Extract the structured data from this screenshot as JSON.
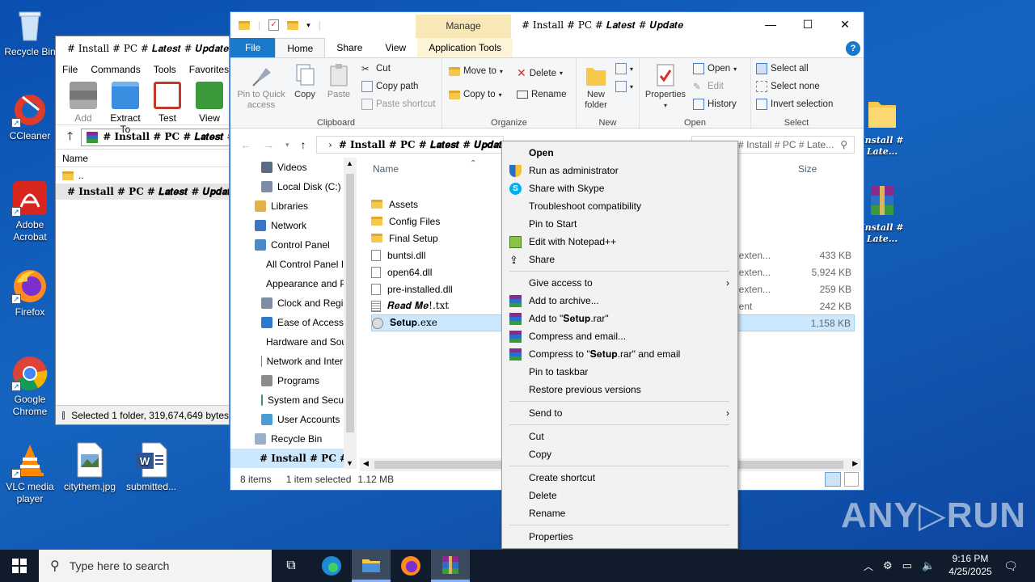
{
  "desktop_icons": [
    {
      "label": "Recycle Bin"
    },
    {
      "label": "CCleaner"
    },
    {
      "label": "Adobe Acrobat"
    },
    {
      "label": "Firefox"
    },
    {
      "label": "Google Chrome"
    },
    {
      "label": "VLC media player"
    },
    {
      "label": "citythem.jpg"
    },
    {
      "label": "submitted..."
    }
  ],
  "right_icons": [
    {
      "line1": "Install #",
      "line2": "Late..."
    },
    {
      "line1": "Install #",
      "line2": "Late..."
    }
  ],
  "winrar": {
    "title": "# Install # PC # 𝑳𝒂𝒕𝒆𝒔𝒕 # 𝑼𝒑𝒅𝒂𝒕𝒆",
    "menu": [
      "File",
      "Commands",
      "Tools",
      "Favorites"
    ],
    "tools": [
      "Add",
      "Extract To",
      "Test",
      "View"
    ],
    "address": "# Install # PC # 𝑳𝒂𝒕𝒆𝒔𝒕 # 𝑼𝒑𝒅𝒂𝒕𝒆",
    "col_name": "Name",
    "rows": [
      "..",
      "# Install # PC # 𝑳𝒂𝒕𝒆𝒔𝒕 # 𝑼𝒑𝒅𝒂𝒕𝒆"
    ],
    "status": "Selected 1 folder, 319,674,649 bytes"
  },
  "explorer": {
    "manage": "Manage",
    "title": "# Install # PC # 𝑳𝒂𝒕𝒆𝒔𝒕 # 𝑼𝒑𝒅𝒂𝒕𝒆",
    "tabs": {
      "file": "File",
      "home": "Home",
      "share": "Share",
      "view": "View",
      "app": "Application Tools"
    },
    "help": "?",
    "ribbon": {
      "clipboard": {
        "label": "Clipboard",
        "pin": "Pin to Quick access",
        "copy": "Copy",
        "paste": "Paste",
        "cut": "Cut",
        "copy_path": "Copy path",
        "paste_shortcut": "Paste shortcut"
      },
      "organize": {
        "label": "Organize",
        "move_to": "Move to",
        "copy_to": "Copy to",
        "delete": "Delete",
        "rename": "Rename"
      },
      "new": {
        "label": "New",
        "new_folder": "New folder"
      },
      "open": {
        "label": "Open",
        "properties": "Properties",
        "open": "Open",
        "edit": "Edit",
        "history": "History"
      },
      "select": {
        "label": "Select",
        "select_all": "Select all",
        "select_none": "Select none",
        "invert": "Invert selection"
      }
    },
    "address": "# Install # PC # 𝑳𝒂𝒕𝒆𝒔𝒕 # 𝑼𝒑𝒅𝒂𝒕𝒆",
    "search_placeholder": "Search # Install # PC # Late...",
    "nav": [
      {
        "label": "Videos",
        "color": "#5b6b84"
      },
      {
        "label": "Local Disk (C:)",
        "color": "#7a8ca8"
      },
      {
        "label": "Libraries",
        "color": "#e2b24a"
      },
      {
        "label": "Network",
        "color": "#3a76c4"
      },
      {
        "label": "Control Panel",
        "color": "#4a8ac8"
      },
      {
        "label": "All Control Panel Items",
        "color": "#4a8ac8"
      },
      {
        "label": "Appearance and Personalization",
        "color": "#6a5fc2"
      },
      {
        "label": "Clock and Region",
        "color": "#7d8ea4"
      },
      {
        "label": "Ease of Access",
        "color": "#2b7ad0"
      },
      {
        "label": "Hardware and Sound",
        "color": "#6b7d92"
      },
      {
        "label": "Network and Internet",
        "color": "#3a8fd0"
      },
      {
        "label": "Programs",
        "color": "#8c8c8c"
      },
      {
        "label": "System and Security",
        "color": "#3a9b5c"
      },
      {
        "label": "User Accounts",
        "color": "#4c9bd6"
      },
      {
        "label": "Recycle Bin",
        "color": "#9ab0c8"
      },
      {
        "label": "# Install # PC # Latest # Update",
        "color": "#f5c84b"
      }
    ],
    "columns": {
      "name": "Name",
      "size": "Size"
    },
    "files": [
      {
        "name": "Assets",
        "type": "r",
        "size": "",
        "kind": "folder"
      },
      {
        "name": "Config Files",
        "type": "r",
        "size": "",
        "kind": "folder"
      },
      {
        "name": "Final Setup",
        "type": "r",
        "size": "",
        "kind": "folder"
      },
      {
        "name": "buntsi.dll",
        "type": "on exten...",
        "size": "433 KB",
        "kind": "dll"
      },
      {
        "name": "open64.dll",
        "type": "on exten...",
        "size": "5,924 KB",
        "kind": "dll"
      },
      {
        "name": "pre-installed.dll",
        "type": "on exten...",
        "size": "259 KB",
        "kind": "dll"
      },
      {
        "name": "𝑹𝒆𝒂𝒅 𝑴𝒆!.txt",
        "type": "ument",
        "size": "242 KB",
        "kind": "txt"
      },
      {
        "name": "𝐒𝐞𝐭𝐮𝐩.exe",
        "type": "on",
        "size": "1,158 KB",
        "kind": "exe"
      }
    ],
    "status": {
      "items": "8 items",
      "selected": "1 item selected",
      "size": "1.12 MB"
    }
  },
  "context_menu": [
    [
      {
        "label": "Open",
        "bold": true
      },
      {
        "label": "Run as administrator",
        "icon": "shield"
      },
      {
        "label": "Share with Skype",
        "icon": "skype"
      },
      {
        "label": "Troubleshoot compatibility"
      },
      {
        "label": "Pin to Start"
      },
      {
        "label": "Edit with Notepad++",
        "icon": "notepad"
      },
      {
        "label": "Share",
        "icon": "share"
      }
    ],
    [
      {
        "label": "Give access to",
        "sub": true
      },
      {
        "label": "Add to archive...",
        "icon": "rar"
      },
      {
        "label": "Add to \"𝐒𝐞𝐭𝐮𝐩.rar\"",
        "icon": "rar"
      },
      {
        "label": "Compress and email...",
        "icon": "rar"
      },
      {
        "label": "Compress to \"𝐒𝐞𝐭𝐮𝐩.rar\" and email",
        "icon": "rar"
      },
      {
        "label": "Pin to taskbar"
      },
      {
        "label": "Restore previous versions"
      }
    ],
    [
      {
        "label": "Send to",
        "sub": true
      }
    ],
    [
      {
        "label": "Cut"
      },
      {
        "label": "Copy"
      }
    ],
    [
      {
        "label": "Create shortcut"
      },
      {
        "label": "Delete"
      },
      {
        "label": "Rename"
      }
    ],
    [
      {
        "label": "Properties"
      }
    ]
  ],
  "taskbar": {
    "search_placeholder": "Type here to search",
    "time": "9:16 PM",
    "date": "4/25/2025"
  },
  "watermark": "ANY▷RUN"
}
